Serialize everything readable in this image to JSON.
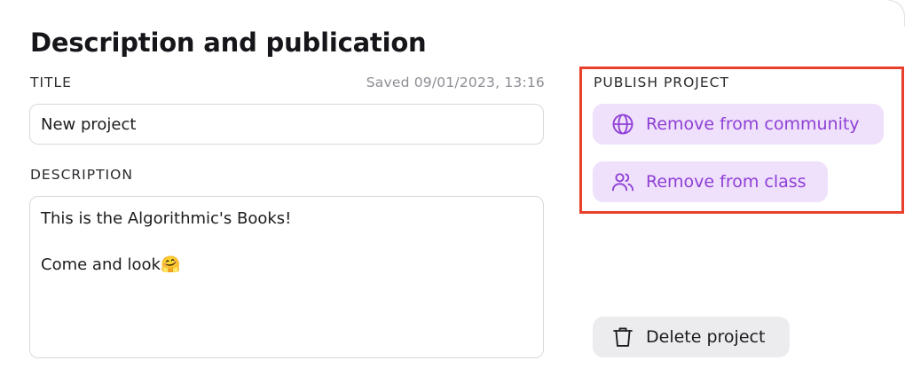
{
  "heading": "Description and publication",
  "title_section": {
    "label": "TITLE",
    "saved_text": "Saved 09/01/2023, 13:16",
    "value": "New project"
  },
  "description_section": {
    "label": "DESCRIPTION",
    "value": "This is the Algorithmic's Books!\n\nCome and look🤗"
  },
  "publish_section": {
    "label": "PUBLISH PROJECT",
    "remove_community_label": "Remove from community",
    "remove_class_label": "Remove from class",
    "highlight_color": "#e8402a"
  },
  "delete_label": "Delete project",
  "icons": {
    "community": "globe-icon",
    "class": "users-icon",
    "delete": "trash-icon"
  },
  "colors": {
    "accent": "#8e3fd6",
    "accent_bg": "#efe0fb",
    "neutral_bg": "#ececef"
  }
}
